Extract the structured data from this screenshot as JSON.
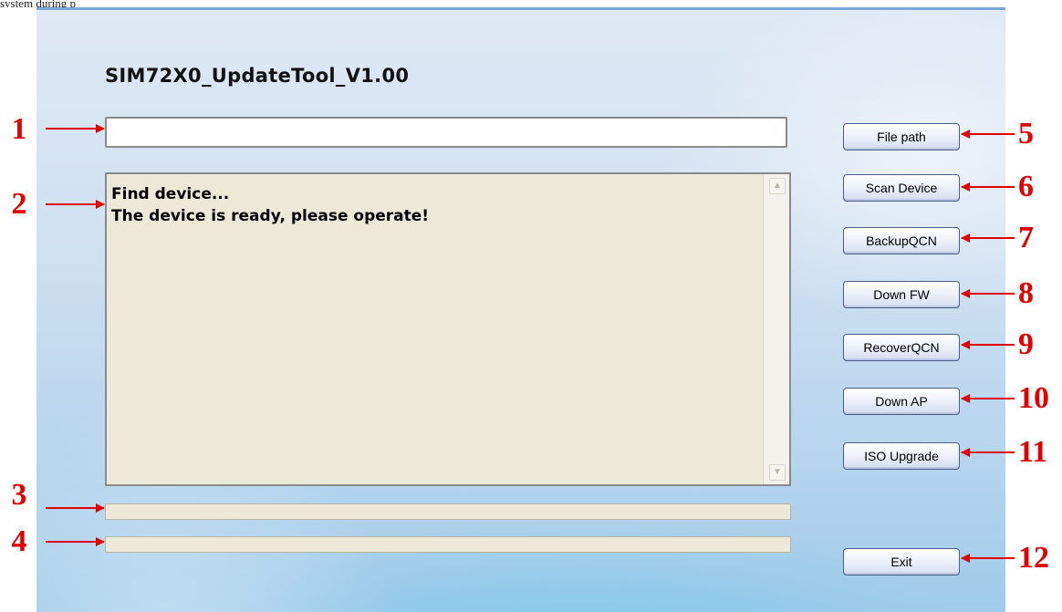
{
  "top_caption": "system during p",
  "window": {
    "title": "SIM72X0_UpdateTool_V1.00",
    "file_path_value": "",
    "log_lines": [
      "Find device...",
      "The device is ready, please operate!"
    ],
    "progress_1": 0,
    "progress_2": 0
  },
  "buttons": {
    "file_path": "File path",
    "scan_device": "Scan Device",
    "backup_qcn": "BackupQCN",
    "down_fw": "Down FW",
    "recover_qcn": "RecoverQCN",
    "down_ap": "Down AP",
    "iso_upgrade": "ISO Upgrade",
    "exit": "Exit"
  },
  "icons": {
    "scroll_up": "triangle-up-icon",
    "scroll_down": "triangle-down-icon"
  },
  "annotations": {
    "a1": "1",
    "a2": "2",
    "a3": "3",
    "a4": "4",
    "a5": "5",
    "a6": "6",
    "a7": "7",
    "a8": "8",
    "a9": "9",
    "a10": "10",
    "a11": "11",
    "a12": "12"
  },
  "colors": {
    "annotation_red": "#e00000",
    "button_border": "#4a5c86",
    "log_background": "#ece9d8"
  }
}
